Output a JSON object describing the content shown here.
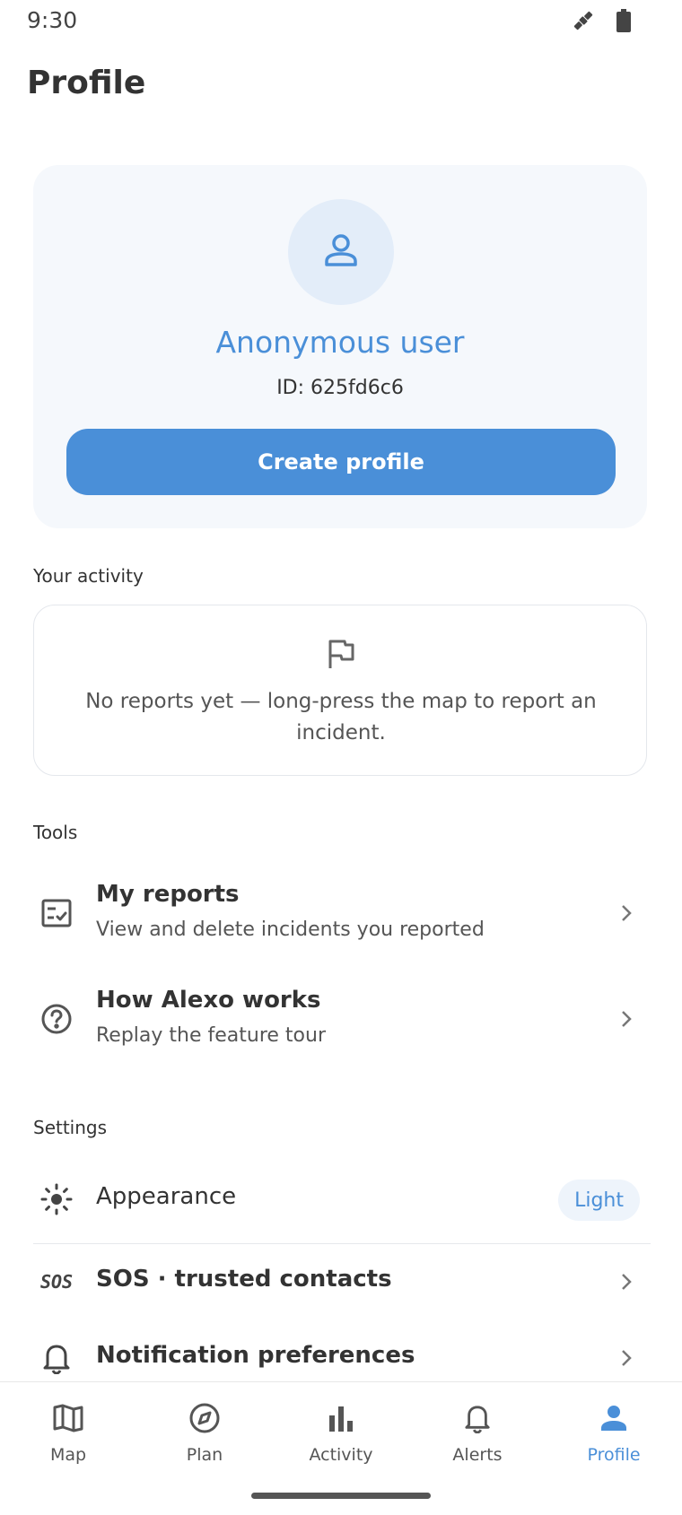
{
  "status": {
    "time": "9:30",
    "icons": [
      "satellite-icon",
      "battery-icon"
    ]
  },
  "page": {
    "title": "Profile"
  },
  "profile": {
    "name": "Anonymous user",
    "id_text": "ID: 625fd6c6",
    "create_label": "Create profile",
    "avatar_icon": "person-outline-icon"
  },
  "activity": {
    "section_label": "Your activity",
    "empty_icon": "flag-icon",
    "empty_text": "No reports yet — long-press the map to report an incident."
  },
  "tools": {
    "section_label": "Tools",
    "items": [
      {
        "title": "My reports",
        "subtitle": "View and delete incidents you reported",
        "icon": "checklist-icon"
      },
      {
        "title": "How Alexo works",
        "subtitle": "Replay the feature tour",
        "icon": "help-circle-icon"
      }
    ]
  },
  "settings": {
    "section_label": "Settings",
    "appearance": {
      "label": "Appearance",
      "value": "Light",
      "icon": "sun-icon"
    },
    "sos": {
      "label": "SOS · trusted contacts",
      "icon_text": "SOS"
    },
    "notifications": {
      "label": "Notification preferences",
      "icon": "bell-icon"
    }
  },
  "nav": {
    "items": [
      {
        "label": "Map",
        "icon": "map-icon"
      },
      {
        "label": "Plan",
        "icon": "compass-icon"
      },
      {
        "label": "Activity",
        "icon": "bar-chart-icon"
      },
      {
        "label": "Alerts",
        "icon": "bell-icon"
      },
      {
        "label": "Profile",
        "icon": "person-icon"
      }
    ],
    "active": "Profile"
  },
  "colors": {
    "accent": "#4a8fd8",
    "card_bg": "#f5f8fc",
    "avatar_bg": "#e3edf9"
  }
}
